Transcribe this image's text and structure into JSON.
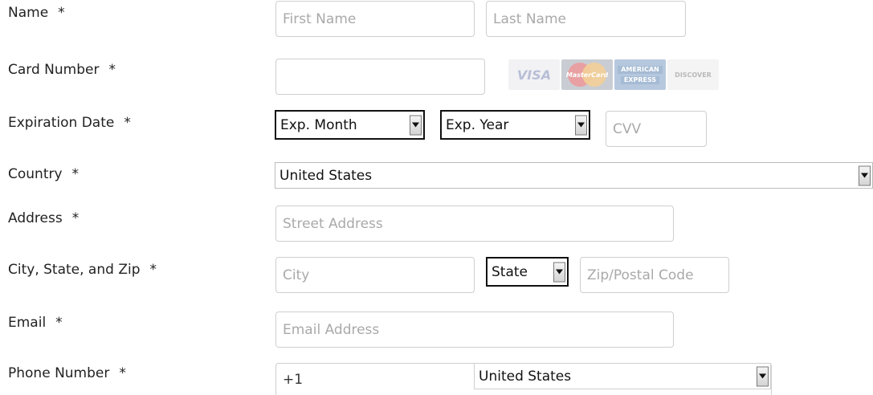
{
  "form": {
    "required_marker": "*",
    "name": {
      "label": "Name",
      "first_placeholder": "First Name",
      "last_placeholder": "Last Name"
    },
    "card": {
      "label": "Card Number",
      "brands": [
        "VISA",
        "MasterCard",
        "AMERICAN",
        "EXPRESS",
        "DISCOVER"
      ]
    },
    "expiration": {
      "label": "Expiration Date",
      "month": "Exp. Month",
      "year": "Exp. Year",
      "cvv_placeholder": "CVV"
    },
    "country": {
      "label": "Country",
      "value": "United States"
    },
    "address": {
      "label": "Address",
      "placeholder": "Street Address"
    },
    "city_state_zip": {
      "label": "City, State, and Zip",
      "city_placeholder": "City",
      "state": "State",
      "zip_placeholder": "Zip/Postal Code"
    },
    "email": {
      "label": "Email",
      "placeholder": "Email Address"
    },
    "phone": {
      "label": "Phone Number",
      "code": "+1",
      "country": "United States"
    }
  }
}
